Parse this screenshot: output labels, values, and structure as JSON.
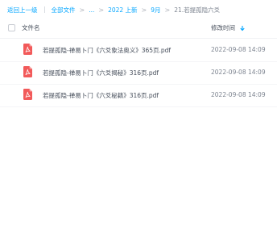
{
  "breadcrumb": {
    "back_label": "返回上一级",
    "all_files_label": "全部文件",
    "ellipsis": "...",
    "folder1": "2022 上新",
    "folder2": "9月",
    "current": "21.若提孤隐六爻"
  },
  "table": {
    "col_name": "文件名",
    "col_modified": "修改时间"
  },
  "files": [
    {
      "name": "若提孤隐-禅易卜门《六爻象法奥义》365页.pdf",
      "modified": "2022-09-08 14:09",
      "icon": "pdf-icon"
    },
    {
      "name": "若提孤隐-禅易卜门《六爻揭秘》316页.pdf",
      "modified": "2022-09-08 14:09",
      "icon": "pdf-icon"
    },
    {
      "name": "若提孤隐-禅易卜门《六爻秘籍》316页.pdf",
      "modified": "2022-09-08 14:09",
      "icon": "pdf-icon"
    }
  ],
  "colors": {
    "accent": "#06a7ff",
    "pdf": "#f25a5a"
  }
}
